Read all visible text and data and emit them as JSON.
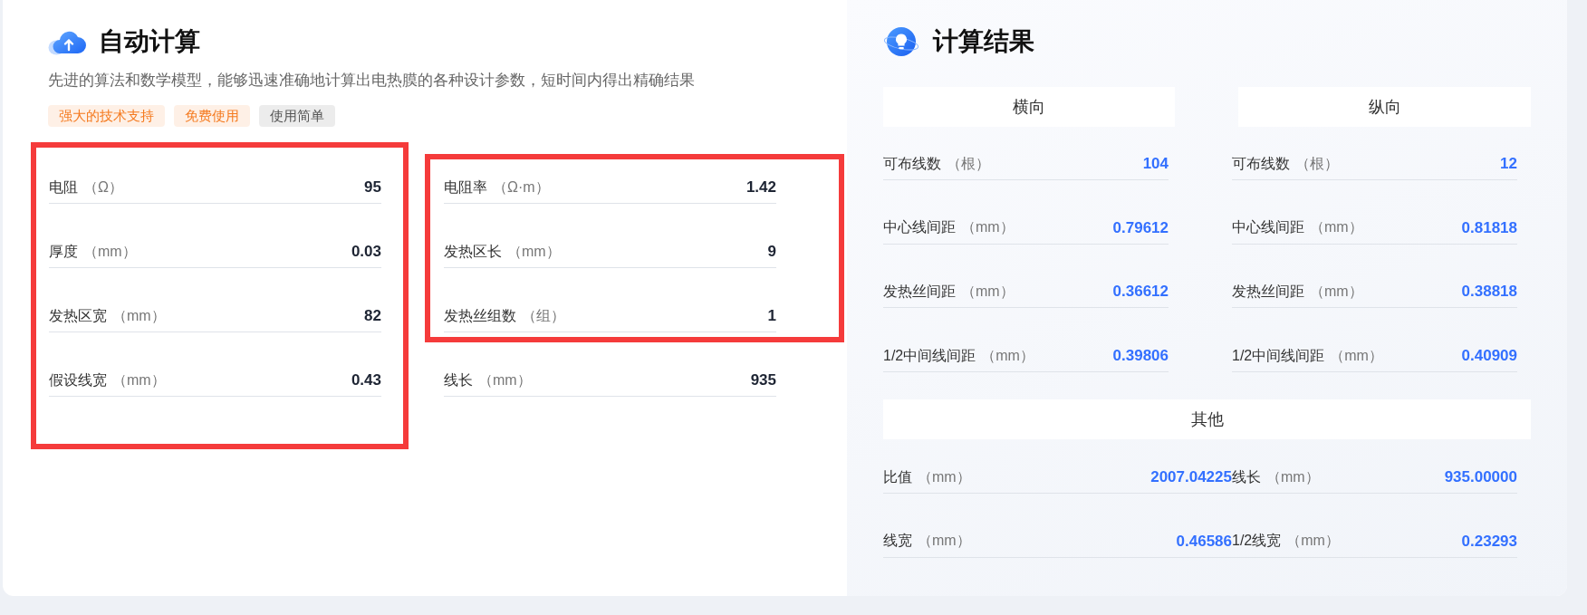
{
  "auto_calc": {
    "title": "自动计算",
    "description": "先进的算法和数学模型，能够迅速准确地计算出电热膜的各种设计参数，短时间内得出精确结果",
    "tags": [
      {
        "text": "强大的技术支持",
        "color": "#f57a1f"
      },
      {
        "text": "免费使用",
        "color": "#f57a1f"
      },
      {
        "text": "使用简单",
        "color": "#555555"
      }
    ],
    "columns": [
      {
        "groups": [
          {
            "highlighted": true,
            "fields": [
              {
                "label": "电阻",
                "unit": "（Ω）",
                "value": "95"
              },
              {
                "label": "厚度",
                "unit": "（mm）",
                "value": "0.03"
              },
              {
                "label": "发热区宽",
                "unit": "（mm）",
                "value": "82"
              },
              {
                "label": "假设线宽",
                "unit": "（mm）",
                "value": "0.43"
              }
            ]
          }
        ]
      },
      {
        "groups": [
          {
            "highlighted": true,
            "fields": [
              {
                "label": "电阻率",
                "unit": "（Ω·m）",
                "value": "1.42"
              },
              {
                "label": "发热区长",
                "unit": "（mm）",
                "value": "9"
              },
              {
                "label": "发热丝组数",
                "unit": "（组）",
                "value": "1"
              }
            ]
          },
          {
            "highlighted": false,
            "fields": [
              {
                "label": "线长",
                "unit": "（mm）",
                "value": "935"
              }
            ]
          }
        ]
      }
    ]
  },
  "results": {
    "title": "计算结果",
    "directions": [
      {
        "heading": "横向",
        "rows": [
          {
            "label": "可布线数",
            "unit": "（根）",
            "value": "104"
          },
          {
            "label": "中心线间距",
            "unit": "（mm）",
            "value": "0.79612"
          },
          {
            "label": "发热丝间距",
            "unit": "（mm）",
            "value": "0.36612"
          },
          {
            "label": "1/2中间线间距",
            "unit": "（mm）",
            "value": "0.39806"
          }
        ]
      },
      {
        "heading": "纵向",
        "rows": [
          {
            "label": "可布线数",
            "unit": "（根）",
            "value": "12"
          },
          {
            "label": "中心线间距",
            "unit": "（mm）",
            "value": "0.81818"
          },
          {
            "label": "发热丝间距",
            "unit": "（mm）",
            "value": "0.38818"
          },
          {
            "label": "1/2中间线间距",
            "unit": "（mm）",
            "value": "0.40909"
          }
        ]
      }
    ],
    "other": {
      "heading": "其他",
      "rows": [
        {
          "label": "比值",
          "unit": "（mm）",
          "value": "2007.04225"
        },
        {
          "label": "线长",
          "unit": "（mm）",
          "value": "935.00000"
        },
        {
          "label": "线宽",
          "unit": "（mm）",
          "value": "0.46586"
        },
        {
          "label": "1/2线宽",
          "unit": "（mm）",
          "value": "0.23293"
        }
      ]
    }
  }
}
